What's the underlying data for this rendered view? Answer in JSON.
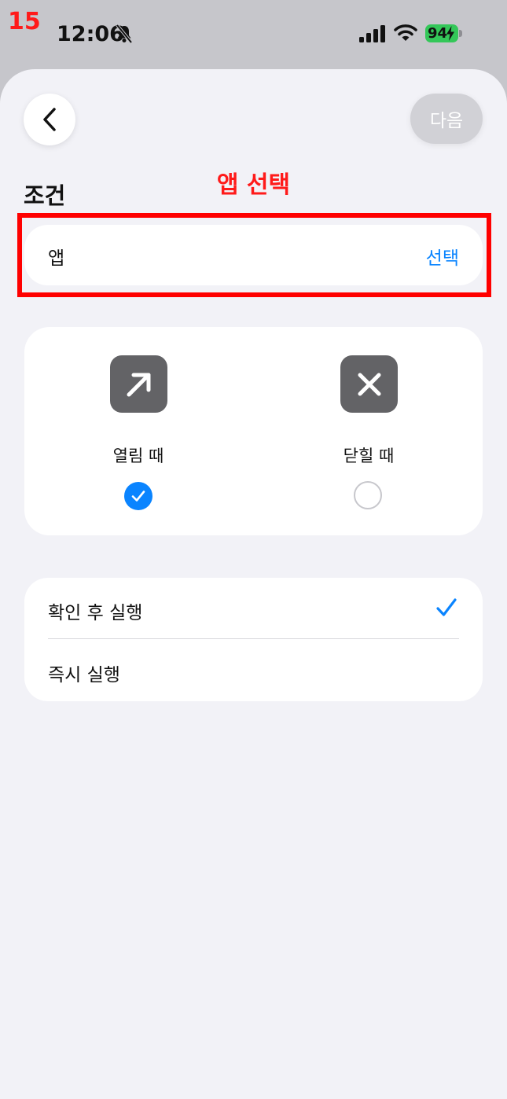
{
  "annotation": {
    "step_number": "15",
    "label": "앱 선택",
    "color": "#ff0000"
  },
  "status_bar": {
    "time": "12:06",
    "battery": "94",
    "icons": [
      "bell-slash-icon",
      "signal-icon",
      "wifi-icon",
      "battery-charging-icon"
    ]
  },
  "header": {
    "back_icon": "chevron-left-icon",
    "next_label": "다음"
  },
  "condition": {
    "title": "조건",
    "app_label": "앱",
    "app_action": "선택"
  },
  "trigger": {
    "options": [
      {
        "label": "열림 때",
        "icon": "arrow-up-right-icon",
        "selected": true
      },
      {
        "label": "닫힐 때",
        "icon": "close-x-icon",
        "selected": false
      }
    ]
  },
  "run_mode": {
    "options": [
      {
        "label": "확인 후 실행",
        "selected": true
      },
      {
        "label": "즉시 실행",
        "selected": false
      }
    ]
  },
  "colors": {
    "accent": "#0a84ff",
    "background": "#f2f2f7",
    "tile": "#636366",
    "battery": "#34c759"
  }
}
